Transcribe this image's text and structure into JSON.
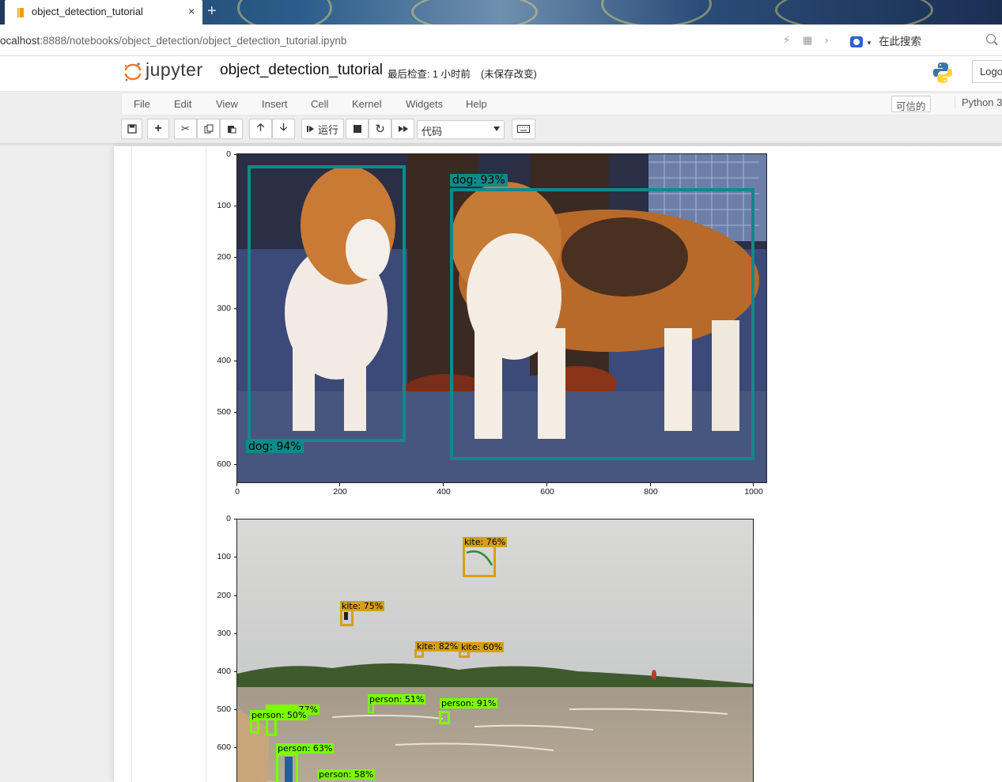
{
  "browser": {
    "tab_title": "object_detection_tutorial",
    "tab_close": "×",
    "new_tab": "+",
    "url_host": "ocalhost",
    "url_rest": ":8888/notebooks/object_detection/object_detection_tutorial.ipynb",
    "search_placeholder": "在此搜索"
  },
  "jupyter": {
    "logo_text": "jupyter",
    "notebook_name": "object_detection_tutorial",
    "checkpoint": "最后检查: 1 小时前",
    "autosave": "(未保存改变)",
    "logout_label": "Logo",
    "menu": [
      "File",
      "Edit",
      "View",
      "Insert",
      "Cell",
      "Kernel",
      "Widgets",
      "Help"
    ],
    "trusted_label": "可信的",
    "kernel_label": "Python 3",
    "run_label": "运行",
    "cell_type": "代码"
  },
  "plot1": {
    "yticks": [
      "0",
      "100",
      "200",
      "300",
      "400",
      "500",
      "600"
    ],
    "xticks": [
      "0",
      "200",
      "400",
      "600",
      "800",
      "1000"
    ],
    "detections": [
      {
        "label": "dog: 94%",
        "color": "#0f8a8a"
      },
      {
        "label": "dog: 93%",
        "color": "#0f8a8a"
      }
    ]
  },
  "plot2": {
    "yticks": [
      "0",
      "100",
      "200",
      "300",
      "400",
      "500",
      "600"
    ],
    "detections": [
      {
        "label": "kite: 76%",
        "color": "#d4a017"
      },
      {
        "label": "kite: 75%",
        "color": "#d4a017"
      },
      {
        "label": "kite: 82%",
        "color": "#d4a017"
      },
      {
        "label": "kite: 60%",
        "color": "#d4a017"
      },
      {
        "label": "person: 51%",
        "color": "#7cfc00"
      },
      {
        "label": "person: 91%",
        "color": "#7cfc00"
      },
      {
        "label": "77%",
        "color": "#7cfc00"
      },
      {
        "label": "person: 50%",
        "color": "#7cfc00"
      },
      {
        "label": "person: 63%",
        "color": "#7cfc00"
      },
      {
        "label": "person: 58%",
        "color": "#7cfc00"
      }
    ]
  }
}
